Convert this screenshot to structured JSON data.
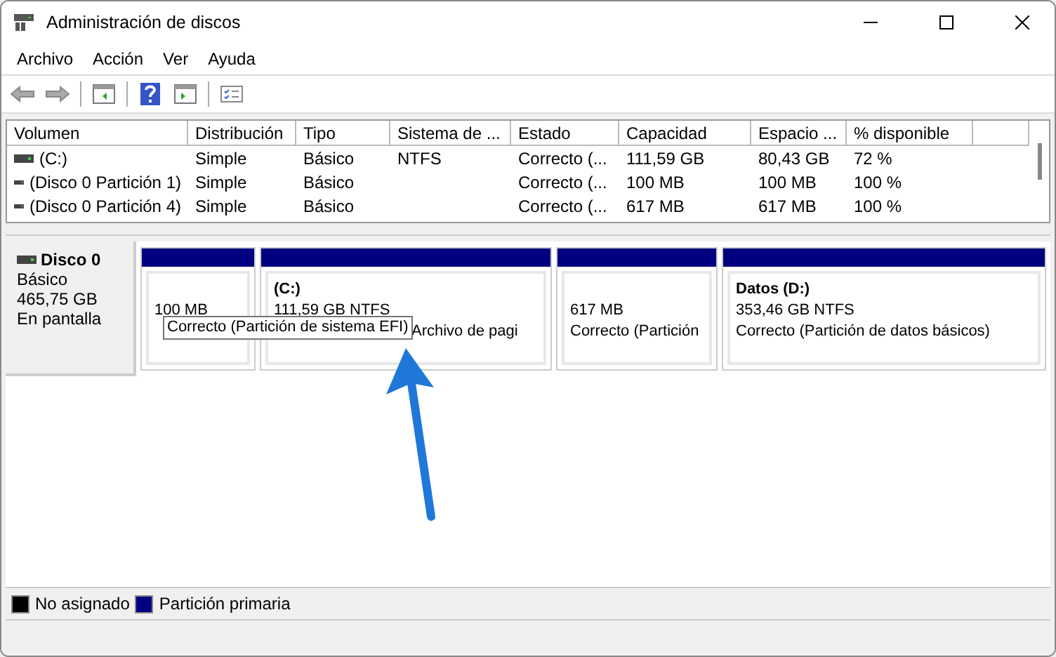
{
  "window": {
    "title": "Administración de discos"
  },
  "menu": [
    "Archivo",
    "Acción",
    "Ver",
    "Ayuda"
  ],
  "table": {
    "columns": [
      "Volumen",
      "Distribución",
      "Tipo",
      "Sistema de ...",
      "Estado",
      "Capacidad",
      "Espacio ...",
      "% disponible"
    ],
    "rows": [
      {
        "cells": [
          "(C:)",
          "Simple",
          "Básico",
          "NTFS",
          "Correcto (...",
          "111,59 GB",
          "80,43 GB",
          "72 %"
        ]
      },
      {
        "cells": [
          "(Disco 0 Partición 1)",
          "Simple",
          "Básico",
          "",
          "Correcto (...",
          "100 MB",
          "100 MB",
          "100 %"
        ]
      },
      {
        "cells": [
          "(Disco 0 Partición 4)",
          "Simple",
          "Básico",
          "",
          "Correcto (...",
          "617 MB",
          "617 MB",
          "100 %"
        ]
      }
    ]
  },
  "disk": {
    "name": "Disco 0",
    "type": "Básico",
    "size": "465,75 GB",
    "status": "En pantalla",
    "partitions": [
      {
        "kind": "primary",
        "color": "#000080",
        "size": "100 MB"
      },
      {
        "kind": "primary",
        "color": "#000080",
        "title": "(C:)",
        "size": "111,59 GB NTFS",
        "status": "Archivo de pagi"
      },
      {
        "kind": "primary",
        "color": "#000080",
        "size": "617 MB",
        "status": "Correcto (Partición"
      },
      {
        "kind": "primary",
        "color": "#000080",
        "title": "Datos  (D:)",
        "size": "353,46 GB NTFS",
        "status": "Correcto (Partición de datos básicos)"
      }
    ]
  },
  "tooltip": "Correcto (Partición de sistema EFI)",
  "legend": [
    {
      "label": "No asignado",
      "color": "#000000"
    },
    {
      "label": "Partición primaria",
      "color": "#000080"
    }
  ]
}
